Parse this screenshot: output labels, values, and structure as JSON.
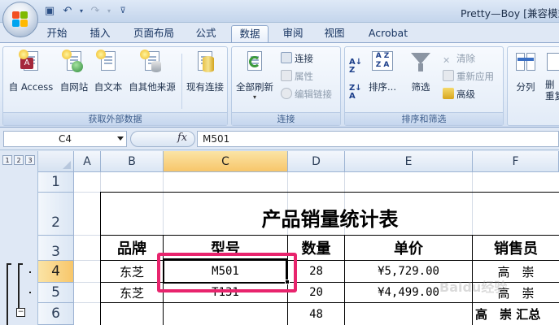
{
  "window": {
    "title": "Pretty—Boy  [兼容模式",
    "qat_icons": [
      "save-icon",
      "undo-icon",
      "redo-icon",
      "customize-qat-icon"
    ]
  },
  "tabs": [
    {
      "label": "开始",
      "active": false
    },
    {
      "label": "插入",
      "active": false
    },
    {
      "label": "页面布局",
      "active": false
    },
    {
      "label": "公式",
      "active": false
    },
    {
      "label": "数据",
      "active": true
    },
    {
      "label": "审阅",
      "active": false
    },
    {
      "label": "视图",
      "active": false
    },
    {
      "label": "Acrobat",
      "active": false
    }
  ],
  "ribbon": {
    "get_external": {
      "label": "获取外部数据",
      "from_access": "自 Access",
      "from_web": "自网站",
      "from_text": "自文本",
      "from_other": "自其他来源",
      "existing": "现有连接"
    },
    "connections": {
      "label": "连接",
      "refresh_all": "全部刷新",
      "connections": "连接",
      "properties": "属性",
      "edit_links": "编辑链接"
    },
    "sort_filter": {
      "label": "排序和筛选",
      "sort": "排序...",
      "filter": "筛选",
      "clear": "清除",
      "reapply": "重新应用",
      "advanced": "高级"
    },
    "data_tools": {
      "split": "分列",
      "remove_dup_1": "删",
      "remove_dup_2": "重复"
    }
  },
  "formula_bar": {
    "name_box": "C4",
    "fx_label": "fx",
    "value": "M501"
  },
  "sheet": {
    "outline_levels": [
      "1",
      "2",
      "3"
    ],
    "collapse_symbol": "−",
    "columns": [
      "A",
      "B",
      "C",
      "D",
      "E",
      "F"
    ],
    "selected_column": "C",
    "rows": [
      "1",
      "2",
      "3",
      "4",
      "5",
      "6"
    ],
    "selected_row": "4",
    "table_title": "产品销量统计表",
    "headers": [
      "品牌",
      "型号",
      "数量",
      "单价",
      "销售员"
    ],
    "data_rows": [
      {
        "brand": "东芝",
        "model": "M501",
        "qty": "28",
        "price": "¥5,729.00",
        "seller": "高　崇"
      },
      {
        "brand": "东芝",
        "model": "T131",
        "qty": "20",
        "price": "¥4,499.00",
        "seller": "高　崇"
      },
      {
        "brand": "",
        "model": "",
        "qty": "48",
        "price": "",
        "seller": "高　崇 汇总"
      }
    ],
    "active_cell": "C4"
  },
  "watermark": "Baidu经验"
}
